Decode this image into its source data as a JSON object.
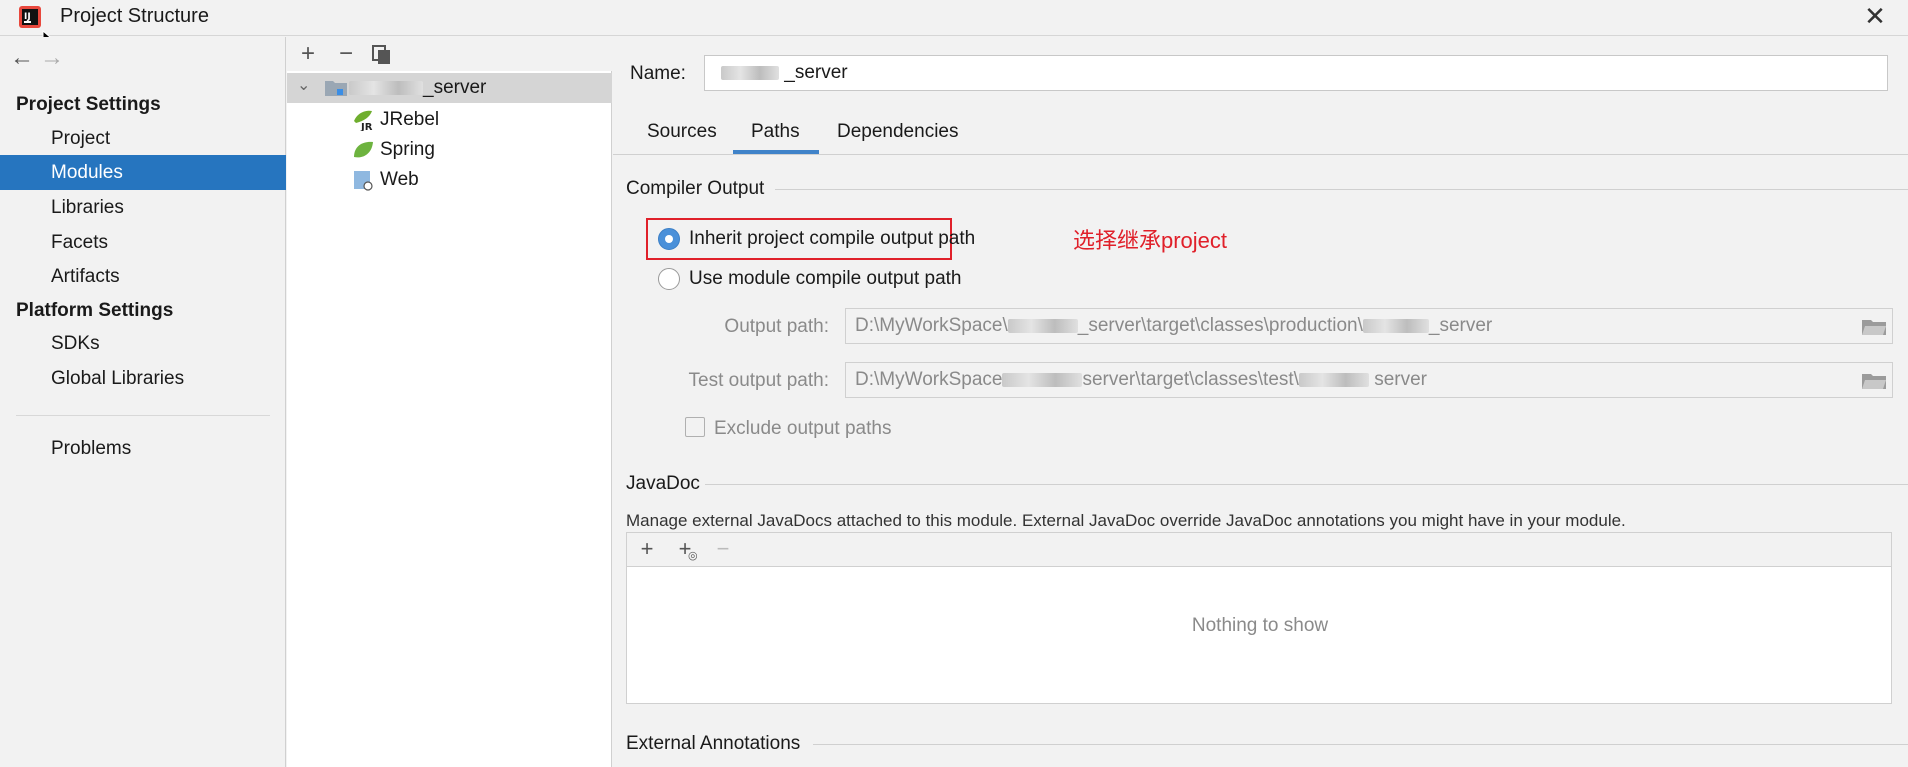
{
  "window": {
    "title": "Project Structure",
    "close_symbol": "✕"
  },
  "nav": {
    "back_symbol": "←",
    "forward_symbol": "→",
    "project_settings_heading": "Project Settings",
    "project_settings_items": [
      {
        "label": "Project",
        "selected": false
      },
      {
        "label": "Modules",
        "selected": true
      },
      {
        "label": "Libraries",
        "selected": false
      },
      {
        "label": "Facets",
        "selected": false
      },
      {
        "label": "Artifacts",
        "selected": false
      }
    ],
    "platform_settings_heading": "Platform Settings",
    "platform_settings_items": [
      {
        "label": "SDKs"
      },
      {
        "label": "Global Libraries"
      }
    ],
    "problems_label": "Problems"
  },
  "tree": {
    "toolbar": {
      "add": "+",
      "remove": "−",
      "copy_icon": "copy-icon"
    },
    "root_suffix": "_server",
    "children": [
      {
        "label": "JRebel",
        "icon": "jrebel-icon"
      },
      {
        "label": "Spring",
        "icon": "spring-leaf-icon"
      },
      {
        "label": "Web",
        "icon": "web-icon"
      }
    ]
  },
  "main": {
    "name_label": "Name:",
    "name_value_suffix": "_server",
    "tabs": [
      {
        "label": "Sources",
        "active": false
      },
      {
        "label": "Paths",
        "active": true
      },
      {
        "label": "Dependencies",
        "active": false
      }
    ],
    "compiler_output": {
      "title": "Compiler Output",
      "inherit_label": "Inherit project compile output path",
      "inherit_selected": true,
      "module_label": "Use module compile output path",
      "module_selected": false,
      "annotation": "选择继承project",
      "output_path_label": "Output path:",
      "output_path_prefix": "D:\\MyWorkSpace\\",
      "output_path_middle": "_server\\target\\classes\\production\\",
      "output_path_suffix": "_server",
      "test_output_path_label": "Test output path:",
      "test_output_path_prefix": "D:\\MyWorkSpace",
      "test_output_path_middle": "server\\target\\classes\\test\\",
      "test_output_path_suffix": "server",
      "exclude_label": "Exclude output paths",
      "exclude_checked": false
    },
    "javadoc": {
      "title": "JavaDoc",
      "description": "Manage external JavaDocs attached to this module. External JavaDoc override JavaDoc annotations you might have in your module.",
      "add": "+",
      "remove": "−",
      "empty_text": "Nothing to show"
    },
    "external_annotations_title": "External Annotations"
  },
  "colors": {
    "selection": "#2675bf",
    "annotation_red": "#e0202a",
    "tab_underline": "#4083c9"
  }
}
